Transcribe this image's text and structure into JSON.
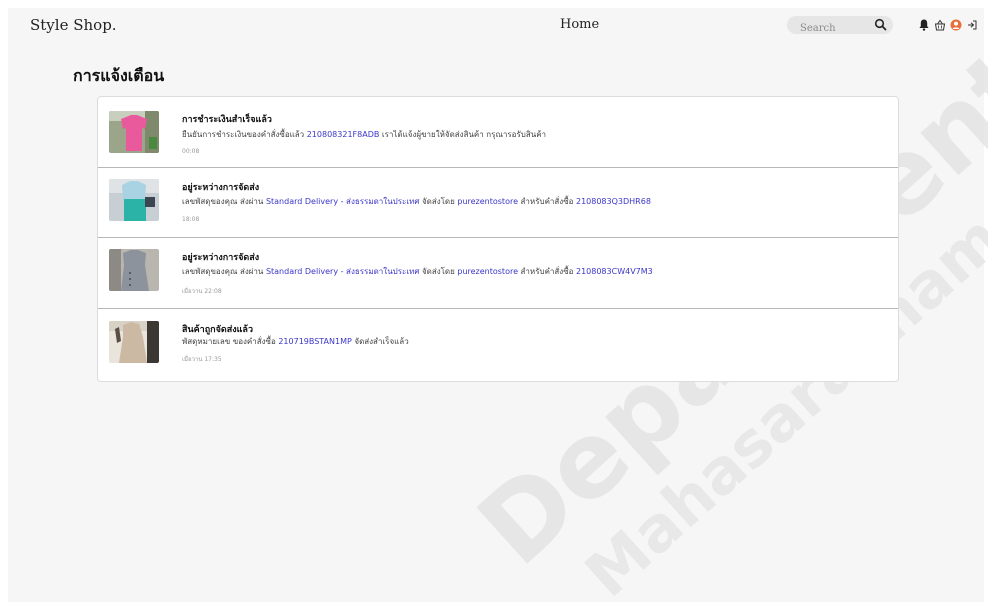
{
  "nav": {
    "brand": "Style Shop.",
    "home": "Home",
    "search_placeholder": "Search",
    "icons": [
      "bell-icon",
      "basket-icon",
      "user-icon",
      "logout-icon"
    ]
  },
  "page": {
    "title": "การแจ้งเตือน"
  },
  "notifications": [
    {
      "title": "การชำระเงินสำเร็จแล้ว",
      "body_pre": "ยืนยันการชำระเงินของคำสั่งซื้อแล้ว ",
      "link1": "210808321F8ADB",
      "body_mid": " เราได้แจ้งผู้ขายให้จัดส่งสินค้า กรุณารอรับสินค้า",
      "link2": "",
      "body_mid2": "",
      "link3": "",
      "time": "00:08",
      "thumb": "pink shirt"
    },
    {
      "title": "อยู่ระหว่างการจัดส่ง",
      "body_pre": "เลขพัสดุของคุณ ส่งผ่าน ",
      "link1": "Standard Delivery - ส่งธรรมดาในประเทศ",
      "body_mid": " จัดส่งโดย ",
      "link2": "purezentostore",
      "body_mid2": " สำหรับคำสั่งซื้อ ",
      "link3": "2108083Q3DHR68",
      "time": "18:08",
      "thumb": "blue top"
    },
    {
      "title": "อยู่ระหว่างการจัดส่ง",
      "body_pre": "เลขพัสดุของคุณ ส่งผ่าน ",
      "link1": "Standard Delivery - ส่งธรรมดาในประเทศ",
      "body_mid": " จัดส่งโดย ",
      "link2": "purezentostore",
      "body_mid2": " สำหรับคำสั่งซื้อ ",
      "link3": "2108083CW4V7M3",
      "time": "เมื่อวาน 22:08",
      "thumb": "grey dress"
    },
    {
      "title": "สินค้าถูกจัดส่งแล้ว",
      "body_pre": "พัสดุหมายเลข ของคำสั่งซื้อ ",
      "link1": "210719BSTAN1MP",
      "body_mid": " จัดส่งสำเร็จแล้ว",
      "link2": "",
      "body_mid2": "",
      "link3": "",
      "time": "เมื่อวาน 17:35",
      "thumb": "beige dress"
    }
  ],
  "watermark": {
    "line1": "Department",
    "line2": "Mahasarakham Universi",
    "color": "#e6e6e6"
  },
  "colors": {
    "link": "#3b36c9",
    "background": "#f6f6f6"
  }
}
